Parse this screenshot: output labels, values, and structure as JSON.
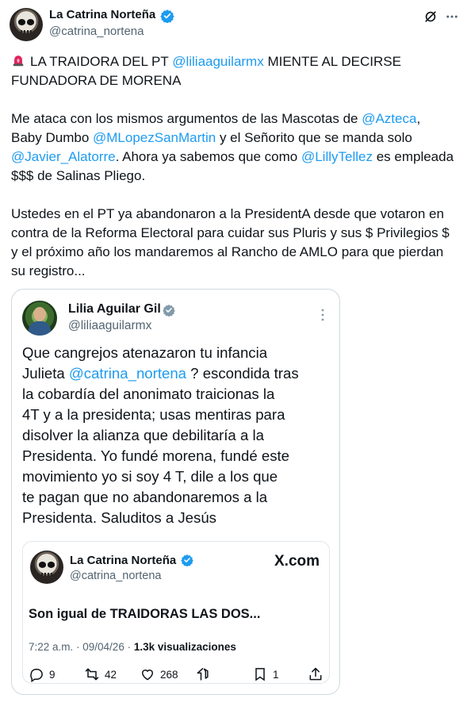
{
  "post": {
    "author_name": "La Catrina Norteña",
    "author_handle": "@catrina_nortena",
    "line1_prefix": "LA TRAIDORA DEL PT ",
    "line1_mention": "@liliaaguilarmx",
    "line1_suffix": "  MIENTE AL DECIRSE",
    "line2": "FUNDADORA DE MORENA",
    "para2_a": "Me ataca con los mismos argumentos de las Mascotas de ",
    "para2_m1": "@Azteca",
    "para2_b": ",",
    "para2_c": "Baby Dumbo ",
    "para2_m2": "@MLopezSanMartin",
    "para2_d": " y el Señorito que se manda solo",
    "para2_m3": "@Javier_Alatorre",
    "para2_e": ". Ahora ya sabemos que como ",
    "para2_m4": "@LillyTellez",
    "para2_f": " es empleada",
    "para2_g": "$$$ de Salinas Pliego.",
    "para3_l1": "Ustedes en el PT ya abandonaron a la PresidentA desde que votaron en",
    "para3_l2": "contra de la Reforma Electoral para cuidar sus Pluris y sus $ Privilegios $",
    "para3_l3": "y el próximo año los mandaremos al Rancho de AMLO para que pierdan",
    "para3_l4": "su registro..."
  },
  "quote": {
    "author_name": "Lilia Aguilar Gil",
    "author_handle": "@liliaaguilarmx",
    "l1": "Que cangrejos atenazaron tu infancia",
    "l2_a": "Julieta ",
    "l2_m": "@catrina_nortena",
    "l2_b": " ? escondida tras",
    "l3": "la cobardía del anonimato traicionas la",
    "l4": "4T y a la presidenta; usas mentiras para",
    "l5": "disolver la alianza que debilitaría a la",
    "l6": "Presidenta. Yo fundé morena, fundé este",
    "l7": "movimiento yo si soy 4 T, dile a los que",
    "l8": "te pagan que no abandonaremos a la",
    "l9": "Presidenta. Saluditos a Jesús"
  },
  "inner": {
    "author_name": "La Catrina Norteña",
    "author_handle": "@catrina_nortena",
    "brand": "X.com",
    "text": "Son igual de TRAIDORAS LAS DOS...",
    "time": "7:22 a.m. · 09/04/26 · ",
    "views_count": "1.3k",
    "views_label": " visualizaciones",
    "replies": "9",
    "reposts": "42",
    "likes": "268",
    "bookmarks": "1"
  },
  "colors": {
    "accent": "#1d9bf0",
    "muted": "#536471",
    "border": "#cfd9de",
    "alert": "#e0245e"
  },
  "icons": [
    "grok-icon",
    "more-icon",
    "alert-light-icon",
    "verified-icon",
    "reply-icon",
    "repost-icon",
    "like-icon",
    "views-icon",
    "bookmark-icon",
    "share-icon"
  ]
}
